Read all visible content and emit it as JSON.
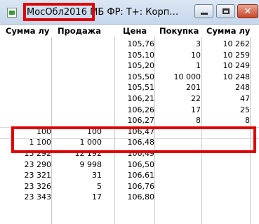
{
  "window": {
    "title_highlight": "МосОбл2016",
    "title_rest": "МБ ФР: Т+: Корп…",
    "buttons": {
      "minimize": "minimize",
      "maximize": "maximize",
      "close": "✕"
    }
  },
  "columns": [
    "Сумма лу",
    "Продажа",
    "Цена",
    "Покупка",
    "Сумма лу"
  ],
  "rows": [
    [
      "",
      "",
      "105,76",
      "3",
      "10 262"
    ],
    [
      "",
      "",
      "105,10",
      "10",
      "10 259"
    ],
    [
      "",
      "",
      "105,20",
      "1",
      "10 249"
    ],
    [
      "",
      "",
      "105,50",
      "10 000",
      "10 248"
    ],
    [
      "",
      "",
      "105,51",
      "201",
      "248"
    ],
    [
      "",
      "",
      "106,21",
      "22",
      "47"
    ],
    [
      "",
      "",
      "106,26",
      "17",
      "25"
    ],
    [
      "",
      "",
      "106,27",
      "8",
      "8"
    ],
    [
      "100",
      "100",
      "106,47",
      "",
      ""
    ],
    [
      "1 100",
      "1 000",
      "106,48",
      "",
      ""
    ],
    [
      "13 292",
      "12 192",
      "106,49",
      "",
      ""
    ],
    [
      "23 290",
      "9 998",
      "106,50",
      "",
      ""
    ],
    [
      "23 321",
      "31",
      "106,61",
      "",
      ""
    ],
    [
      "23 326",
      "5",
      "106,76",
      "",
      ""
    ],
    [
      "23 343",
      "17",
      "106,80",
      "",
      ""
    ]
  ],
  "colors": {
    "highlight": "#e00000",
    "titlebar": "#c6d7ec"
  }
}
